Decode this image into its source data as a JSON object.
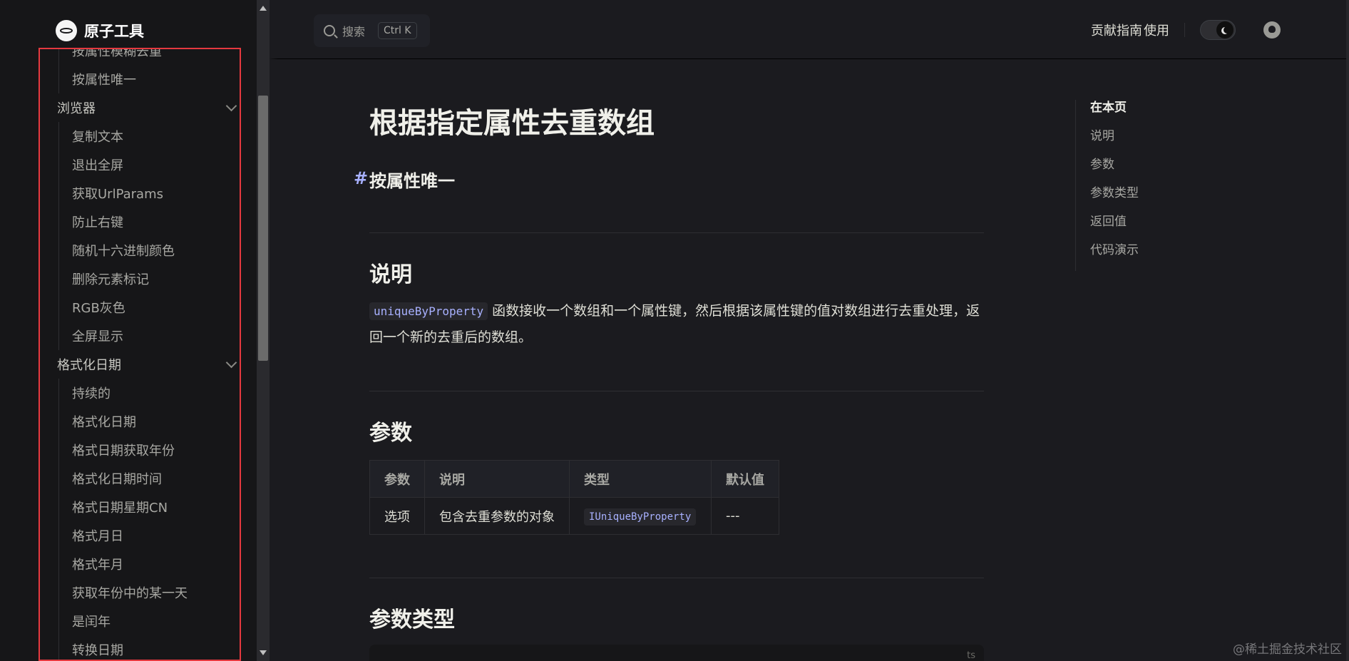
{
  "brand": {
    "name": "原子工具"
  },
  "sidebar": {
    "items": [
      {
        "label": "按属性模糊去重",
        "type": "child"
      },
      {
        "label": "按属性唯一",
        "type": "child"
      },
      {
        "label": "浏览器",
        "type": "group"
      },
      {
        "label": "复制文本",
        "type": "child"
      },
      {
        "label": "退出全屏",
        "type": "child"
      },
      {
        "label": "获取UrlParams",
        "type": "child"
      },
      {
        "label": "防止右键",
        "type": "child"
      },
      {
        "label": "随机十六进制颜色",
        "type": "child"
      },
      {
        "label": "删除元素标记",
        "type": "child"
      },
      {
        "label": "RGB灰色",
        "type": "child"
      },
      {
        "label": "全屏显示",
        "type": "child"
      },
      {
        "label": "格式化日期",
        "type": "group"
      },
      {
        "label": "持续的",
        "type": "child"
      },
      {
        "label": "格式化日期",
        "type": "child"
      },
      {
        "label": "格式日期获取年份",
        "type": "child"
      },
      {
        "label": "格式化日期时间",
        "type": "child"
      },
      {
        "label": "格式日期星期CN",
        "type": "child"
      },
      {
        "label": "格式月日",
        "type": "child"
      },
      {
        "label": "格式年月",
        "type": "child"
      },
      {
        "label": "获取年份中的某一天",
        "type": "child"
      },
      {
        "label": "是闰年",
        "type": "child"
      },
      {
        "label": "转换日期",
        "type": "child"
      }
    ]
  },
  "topbar": {
    "search_label": "搜索",
    "shortcut": "Ctrl K",
    "contribute": "贡献指南",
    "usage": "使用"
  },
  "main": {
    "title": "根据指定属性去重数组",
    "subtitle_hash": "#",
    "subtitle": "按属性唯一",
    "section_desc": "说明",
    "desc_code": "uniqueByProperty",
    "desc_text": " 函数接收一个数组和一个属性键，然后根据该属性键的值对数组进行去重处理，返回一个新的去重后的数组。",
    "section_params": "参数",
    "table": {
      "headers": [
        "参数",
        "说明",
        "类型",
        "默认值"
      ],
      "rows": [
        {
          "param": "选项",
          "desc": "包含去重参数的对象",
          "type": "IUniqueByProperty",
          "default": "---"
        }
      ]
    },
    "section_types": "参数类型",
    "code_lang": "ts"
  },
  "outline": {
    "title": "在本页",
    "items": [
      "说明",
      "参数",
      "参数类型",
      "返回值",
      "代码演示"
    ]
  },
  "watermark": "@稀土掘金技术社区",
  "colors": {
    "accent": "#a8b1ff",
    "highlight_border": "#e5393f",
    "bg": "#1b1b1f"
  }
}
